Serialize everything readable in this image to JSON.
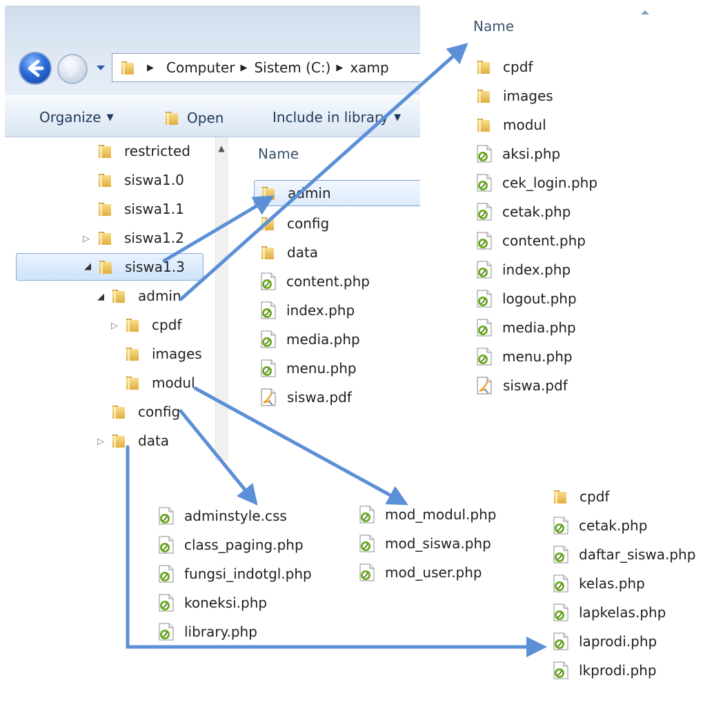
{
  "address": {
    "crumbs": [
      "Computer",
      "Sistem (C:)",
      "xamp"
    ]
  },
  "toolbar": {
    "organize_label": "Organize",
    "open_label": "Open",
    "include_label": "Include in library"
  },
  "tree": {
    "items": [
      {
        "label": "restricted"
      },
      {
        "label": "siswa1.0"
      },
      {
        "label": "siswa1.1"
      },
      {
        "label": "siswa1.2"
      },
      {
        "label": "siswa1.3"
      },
      {
        "label": "admin"
      },
      {
        "label": "cpdf"
      },
      {
        "label": "images"
      },
      {
        "label": "modul"
      },
      {
        "label": "config"
      },
      {
        "label": "data"
      }
    ]
  },
  "content": {
    "column_name": "Name",
    "items": [
      {
        "label": "admin",
        "type": "folder"
      },
      {
        "label": "config",
        "type": "folder"
      },
      {
        "label": "data",
        "type": "folder"
      },
      {
        "label": "content.php",
        "type": "php"
      },
      {
        "label": "index.php",
        "type": "php"
      },
      {
        "label": "media.php",
        "type": "php"
      },
      {
        "label": "menu.php",
        "type": "php"
      },
      {
        "label": "siswa.pdf",
        "type": "pdf"
      }
    ]
  },
  "admin_panel": {
    "column_name": "Name",
    "items": [
      {
        "label": "cpdf",
        "type": "folder"
      },
      {
        "label": "images",
        "type": "folder"
      },
      {
        "label": "modul",
        "type": "folder"
      },
      {
        "label": "aksi.php",
        "type": "php"
      },
      {
        "label": "cek_login.php",
        "type": "php"
      },
      {
        "label": "cetak.php",
        "type": "php"
      },
      {
        "label": "content.php",
        "type": "php"
      },
      {
        "label": "index.php",
        "type": "php"
      },
      {
        "label": "logout.php",
        "type": "php"
      },
      {
        "label": "media.php",
        "type": "php"
      },
      {
        "label": "menu.php",
        "type": "php"
      },
      {
        "label": "siswa.pdf",
        "type": "pdf"
      }
    ]
  },
  "config_panel": {
    "items": [
      {
        "label": "adminstyle.css"
      },
      {
        "label": "class_paging.php"
      },
      {
        "label": "fungsi_indotgl.php"
      },
      {
        "label": "koneksi.php"
      },
      {
        "label": "library.php"
      }
    ]
  },
  "modul_panel": {
    "items": [
      {
        "label": "mod_modul.php"
      },
      {
        "label": "mod_siswa.php"
      },
      {
        "label": "mod_user.php"
      }
    ]
  },
  "data_panel": {
    "items": [
      {
        "label": "cpdf",
        "type": "folder"
      },
      {
        "label": "cetak.php",
        "type": "php"
      },
      {
        "label": "daftar_siswa.php",
        "type": "php"
      },
      {
        "label": "kelas.php",
        "type": "php"
      },
      {
        "label": "lapkelas.php",
        "type": "php"
      },
      {
        "label": "laprodi.php",
        "type": "php"
      },
      {
        "label": "lkprodi.php",
        "type": "php"
      }
    ]
  },
  "colors": {
    "arrow": "#5b8fd6",
    "folder": "#e9c45a",
    "php_icon": "#6aaa1e",
    "selection": "#cfe3fb"
  }
}
